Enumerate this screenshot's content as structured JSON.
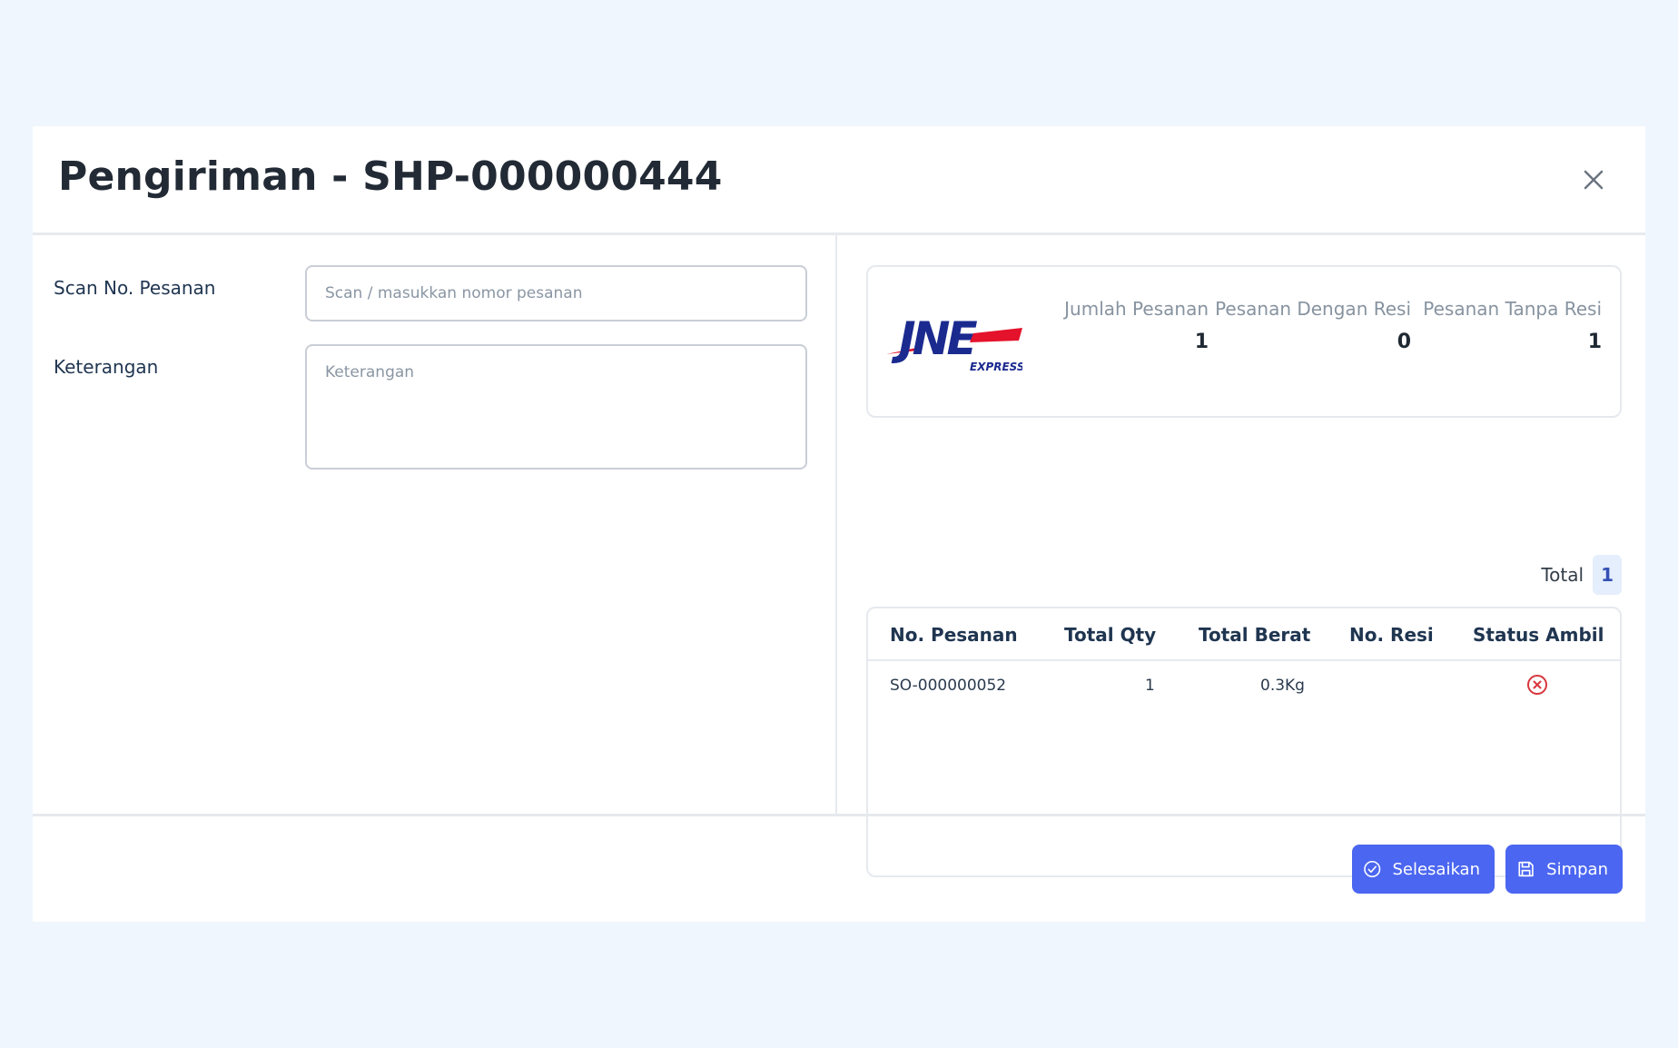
{
  "modal": {
    "title": "Pengiriman - SHP-000000444"
  },
  "form": {
    "scan_label": "Scan No. Pesanan",
    "scan_placeholder": "Scan / masukkan nomor pesanan",
    "scan_value": "",
    "note_label": "Keterangan",
    "note_placeholder": "Keterangan",
    "note_value": ""
  },
  "courier": {
    "logo_name": "JNE EXPRESS",
    "stats": [
      {
        "label": "Jumlah Pesanan",
        "value": "1"
      },
      {
        "label": "Pesanan Dengan Resi",
        "value": "0"
      },
      {
        "label": "Pesanan Tanpa Resi",
        "value": "1"
      }
    ]
  },
  "summary": {
    "total_label": "Total",
    "total_value": "1"
  },
  "table": {
    "headers": [
      "No. Pesanan",
      "Total Qty",
      "Total Berat",
      "No. Resi",
      "Status Ambil"
    ],
    "rows": [
      {
        "order_no": "SO-000000052",
        "qty": "1",
        "weight": "0.3Kg",
        "resi": "",
        "status_icon": "x-circle-icon"
      }
    ]
  },
  "footer": {
    "complete_label": "Selesaikan",
    "save_label": "Simpan"
  },
  "colors": {
    "primary": "#4b66f0",
    "background": "#eff6fd",
    "danger": "#d9363e",
    "jne_blue": "#1b2a8f",
    "jne_red": "#e4122a"
  }
}
